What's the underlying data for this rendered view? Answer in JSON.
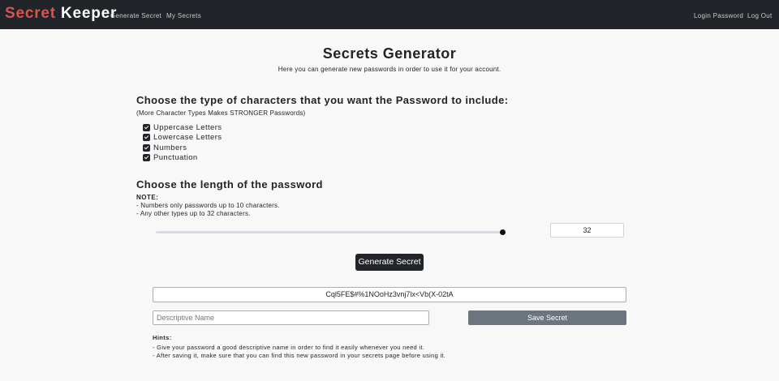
{
  "navbar": {
    "brand_part1": "Secret",
    "brand_part2": "Keeper",
    "links": [
      "Generate Secret",
      "My Secrets"
    ],
    "right_links": [
      "Login Password",
      "Log Out"
    ]
  },
  "header": {
    "title": "Secrets Generator",
    "subtitle": "Here you can generate new passwords in order to use it for your account."
  },
  "char_types": {
    "heading": "Choose the type of characters that you want the Password to include:",
    "note": "(More Character Types Makes STRONGER Passwords)",
    "options": [
      {
        "label": "Uppercase Letters",
        "checked": true
      },
      {
        "label": "Lowercase Letters",
        "checked": true
      },
      {
        "label": "Numbers",
        "checked": true
      },
      {
        "label": "Punctuation",
        "checked": true
      }
    ]
  },
  "length": {
    "heading": "Choose the length of the password",
    "note_title": "NOTE:",
    "note_lines": [
      "- Numbers only passwords up to 10 characters.",
      "- Any other types up to 32 characters."
    ],
    "value": "32",
    "slider_max": 32
  },
  "generate_button": "Generate Secret",
  "result": "Cql5FE$#%1NOoHz3vnj7lx<Vb(X-02tA",
  "name_input_placeholder": "Descriptive Name",
  "save_button": "Save Secret",
  "hints": {
    "title": "Hints:",
    "lines": [
      "- Give your password a good descriptive name in order to find it easily whenever you need it.",
      "- After saving it, make sure that you can find this new password in your secrets page before using it."
    ]
  },
  "colors": {
    "navbar_bg": "#212529",
    "brand_accent": "#d9534f",
    "save_button_bg": "#6c757d"
  }
}
